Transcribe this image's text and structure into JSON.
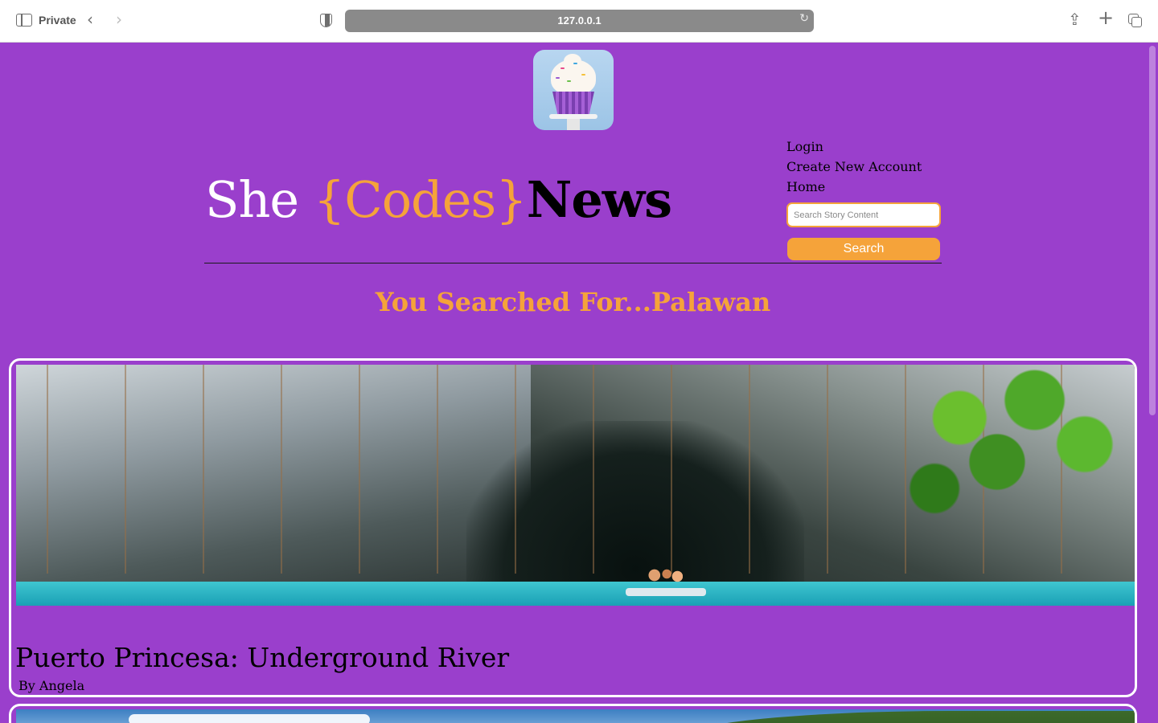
{
  "browser": {
    "private_label": "Private",
    "url": "127.0.0.1"
  },
  "site": {
    "title_she": "She",
    "title_codes": "{Codes}",
    "title_news": "News"
  },
  "nav": {
    "login": "Login",
    "create_account": "Create New Account",
    "home": "Home"
  },
  "search": {
    "placeholder": "Search Story Content",
    "value": "",
    "button_label": "Search"
  },
  "results": {
    "heading": "You Searched For...Palawan",
    "stories": [
      {
        "title": "Puerto Princesa: Underground River",
        "author": "By Angela"
      }
    ]
  },
  "colors": {
    "page_background": "#9a3fcc",
    "accent_orange": "#f5a33a",
    "card_border": "#ffffff"
  },
  "icons": {
    "sidebar": "sidebar-icon",
    "back": "chevron-left-icon",
    "forward": "chevron-right-icon",
    "privacy": "shield-icon",
    "reload": "reload-icon",
    "share": "share-icon",
    "new_tab": "plus-icon",
    "tabs": "tabs-overview-icon"
  }
}
